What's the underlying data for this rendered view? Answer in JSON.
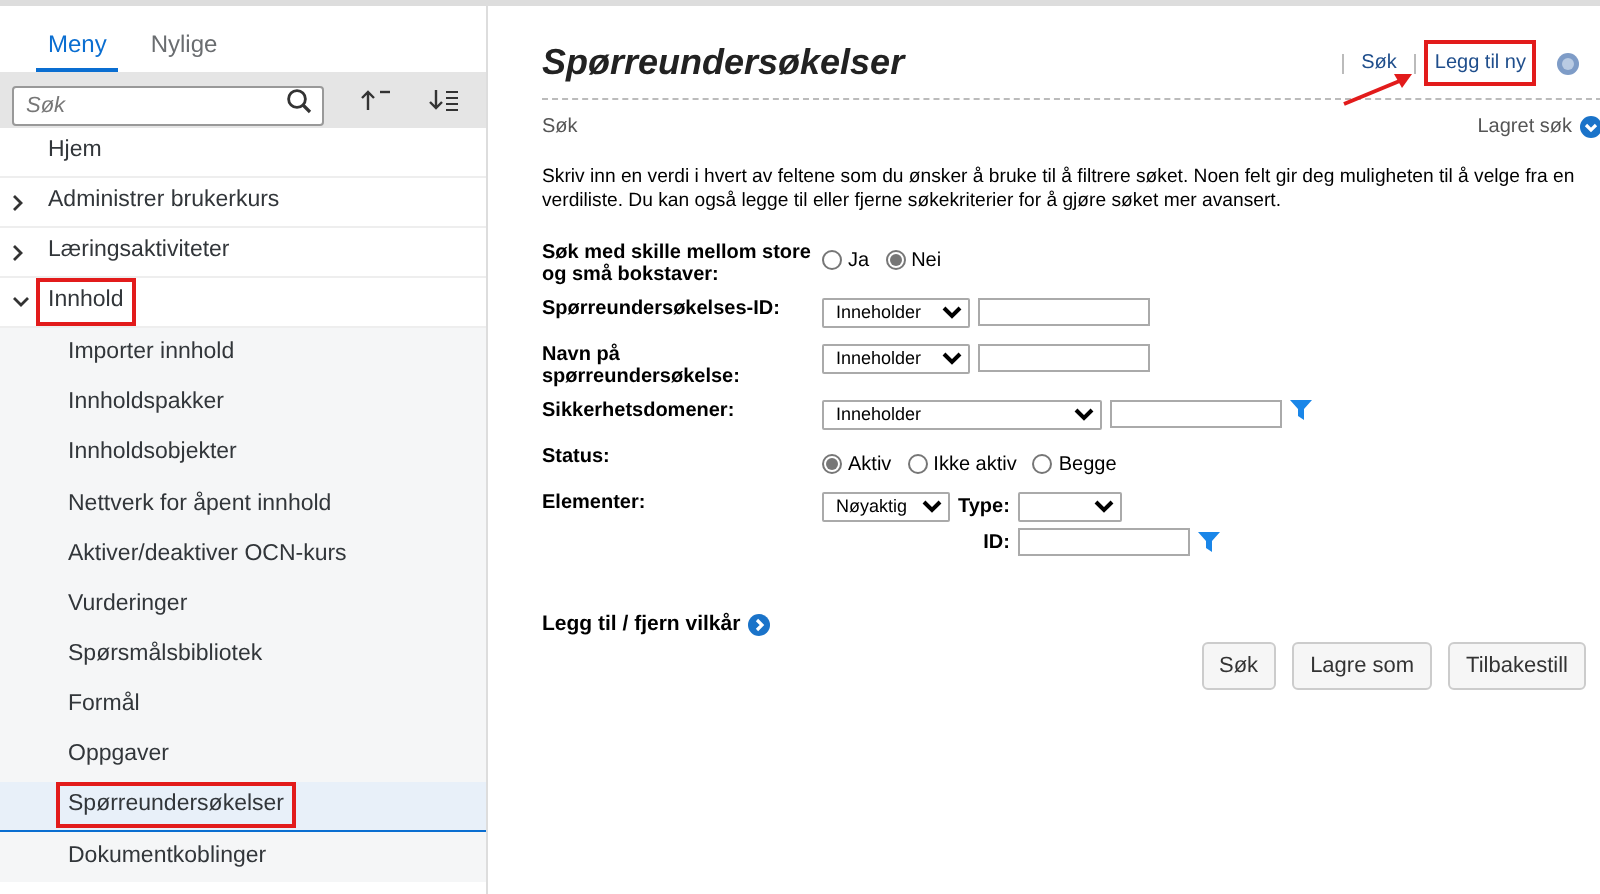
{
  "sidebar": {
    "tabs": [
      {
        "label": "Meny",
        "selected": true
      },
      {
        "label": "Nylige",
        "selected": false
      }
    ],
    "search": {
      "placeholder": "Søk"
    },
    "items": [
      {
        "label": "Hjem",
        "kind": "leaf",
        "highlighted": false
      },
      {
        "label": "Administrer brukerkurs",
        "kind": "group",
        "expanded": false,
        "highlighted": false
      },
      {
        "label": "Læringsaktiviteter",
        "kind": "group",
        "expanded": false,
        "highlighted": false
      },
      {
        "label": "Innhold",
        "kind": "group",
        "expanded": true,
        "highlighted": true,
        "children": [
          {
            "label": "Importer innhold",
            "selected": false,
            "highlighted": false
          },
          {
            "label": "Innholdspakker",
            "selected": false,
            "highlighted": false
          },
          {
            "label": "Innholdsobjekter",
            "selected": false,
            "highlighted": false
          },
          {
            "label": "Nettverk for åpent innhold",
            "selected": false,
            "highlighted": false
          },
          {
            "label": "Aktiver/deaktiver OCN-kurs",
            "selected": false,
            "highlighted": false
          },
          {
            "label": "Vurderinger",
            "selected": false,
            "highlighted": false
          },
          {
            "label": "Spørsmålsbibliotek",
            "selected": false,
            "highlighted": false
          },
          {
            "label": "Formål",
            "selected": false,
            "highlighted": false
          },
          {
            "label": "Oppgaver",
            "selected": false,
            "highlighted": false
          },
          {
            "label": "Spørreundersøkelser",
            "selected": true,
            "highlighted": true
          },
          {
            "label": "Dokumentkoblinger",
            "selected": false,
            "highlighted": false
          }
        ]
      }
    ]
  },
  "main": {
    "title": "Spørreundersøkelser",
    "header_links": [
      {
        "label": "Søk",
        "highlighted": false
      },
      {
        "label": "Legg til ny",
        "highlighted": true
      }
    ],
    "section_label": "Søk",
    "saved_search": "Lagret søk",
    "instructions": "Skriv inn en verdi i hvert av feltene som du ønsker å bruke til å filtrere søket. Noen felt gir deg muligheten til å velge fra en verdiliste. Du kan også legge til eller fjerne søkekriterier for å gjøre søket mer avansert.",
    "fields": [
      {
        "kind": "radio",
        "label": "Søk med skille mellom store og små bokstaver:",
        "options": [
          {
            "label": "Ja",
            "selected": false
          },
          {
            "label": "Nei",
            "selected": true
          }
        ]
      },
      {
        "kind": "text",
        "label": "Spørreundersøkelses-ID:",
        "operator": "Inneholder",
        "wide": false,
        "filter": false
      },
      {
        "kind": "text",
        "label": "Navn på spørreundersøkelse:",
        "operator": "Inneholder",
        "wide": false,
        "filter": false
      },
      {
        "kind": "text",
        "label": "Sikkerhetsdomener:",
        "operator": "Inneholder",
        "wide": true,
        "filter": true
      },
      {
        "kind": "radio",
        "label": "Status:",
        "options": [
          {
            "label": "Aktiv",
            "selected": true
          },
          {
            "label": "Ikke aktiv",
            "selected": false
          },
          {
            "label": "Begge",
            "selected": false
          }
        ]
      },
      {
        "kind": "elements",
        "label": "Elementer:",
        "operator": "Nøyaktig",
        "type_label": "Type:",
        "id_label": "ID:",
        "filter": true
      }
    ],
    "add_remove": "Legg til / fjern vilkår",
    "buttons": [
      "Søk",
      "Lagre som",
      "Tilbakestill"
    ]
  }
}
